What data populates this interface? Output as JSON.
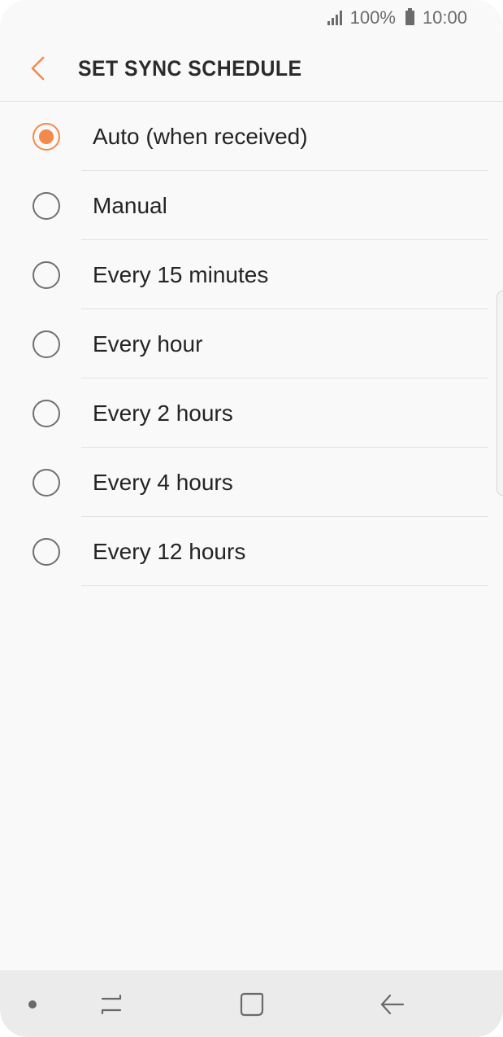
{
  "status_bar": {
    "battery_text": "100%",
    "time": "10:00"
  },
  "header": {
    "title": "SET SYNC SCHEDULE"
  },
  "options": [
    {
      "label": "Auto (when received)",
      "selected": true
    },
    {
      "label": "Manual",
      "selected": false
    },
    {
      "label": "Every 15 minutes",
      "selected": false
    },
    {
      "label": "Every hour",
      "selected": false
    },
    {
      "label": "Every 2 hours",
      "selected": false
    },
    {
      "label": "Every 4 hours",
      "selected": false
    },
    {
      "label": "Every 12 hours",
      "selected": false
    }
  ],
  "colors": {
    "accent": "#f5894a",
    "text": "#242424",
    "background": "#f9f9f9",
    "nav_bar": "#ebebeb"
  },
  "icons": {
    "back": "back-arrow-icon",
    "signal": "signal-icon",
    "battery": "battery-icon",
    "recent": "recent-apps-icon",
    "home": "home-icon",
    "nav_back": "nav-back-icon"
  }
}
